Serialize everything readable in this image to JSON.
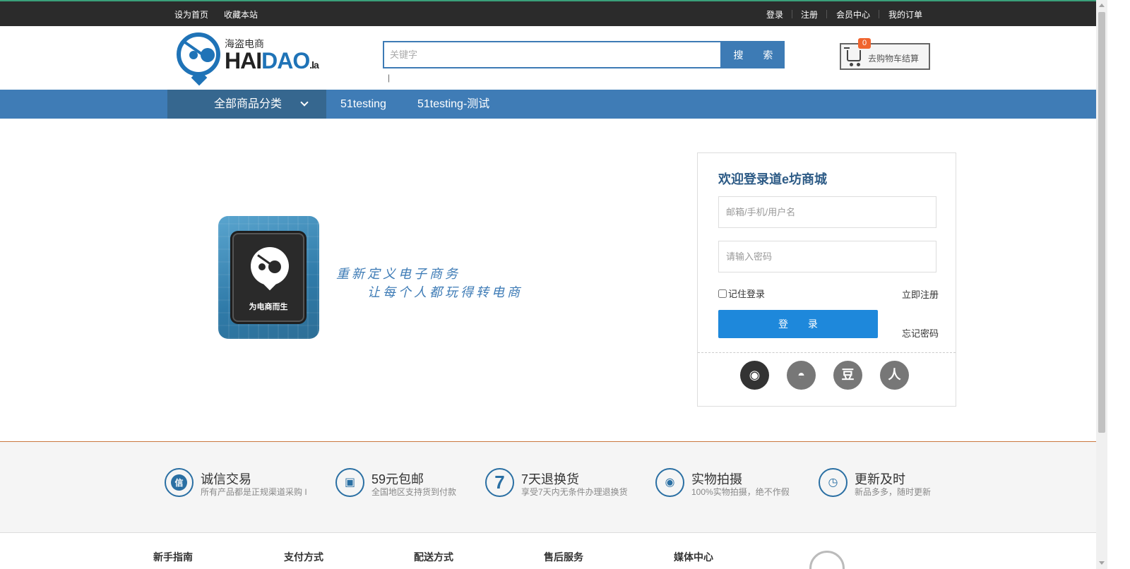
{
  "topbar": {
    "left_links": [
      "设为首页",
      "收藏本站"
    ],
    "right_links": [
      "登录",
      "注册",
      "会员中心",
      "我的订单"
    ]
  },
  "logo": {
    "cn": "海盗电商",
    "en_hai": "HAI",
    "en_dao": "DAO",
    "en_la": ".la"
  },
  "search": {
    "placeholder": "关键字",
    "button_label": "搜 索",
    "hot_words": "|"
  },
  "cart": {
    "count": "0",
    "label": "去购物车结算"
  },
  "nav": {
    "all_categories": "全部商品分类",
    "links": [
      "51testing",
      "51testing-测试"
    ]
  },
  "hero": {
    "tile_text": "为电商而生",
    "slogan_line1": "重新定义电子商务",
    "slogan_line2": "让每个人都玩得转电商"
  },
  "login": {
    "title": "欢迎登录道e坊商城",
    "username_placeholder": "邮箱/手机/用户名",
    "password_placeholder": "请输入密码",
    "remember_label": "记住登录",
    "register_link": "立即注册",
    "login_button": "登 录",
    "forgot_link": "忘记密码",
    "social": [
      {
        "name": "weibo-icon",
        "glyph": "◉"
      },
      {
        "name": "qq-icon",
        "glyph": "◓"
      },
      {
        "name": "douban-icon",
        "glyph": "豆"
      },
      {
        "name": "renren-icon",
        "glyph": "人"
      }
    ]
  },
  "services": [
    {
      "icon": "信",
      "title": "诚信交易",
      "sub": "所有产品都是正规渠道采购 I"
    },
    {
      "icon": "▣",
      "title": "59元包邮",
      "sub": "全国地区支持货到付款"
    },
    {
      "icon": "7",
      "title": "7天退换货",
      "sub": "享受7天内无条件办理退换货"
    },
    {
      "icon": "◉",
      "title": "实物拍摄",
      "sub": "100%实物拍摄，绝不作假"
    },
    {
      "icon": "◷",
      "title": "更新及时",
      "sub": "新品多多，随时更新"
    }
  ],
  "footer_headings": [
    "新手指南",
    "支付方式",
    "配送方式",
    "售后服务",
    "媒体中心"
  ],
  "colors": {
    "brand_blue": "#3f7cb6",
    "topbar": "#2b2b2b",
    "login_button": "#1e88db",
    "cart_badge": "#f0642e"
  }
}
